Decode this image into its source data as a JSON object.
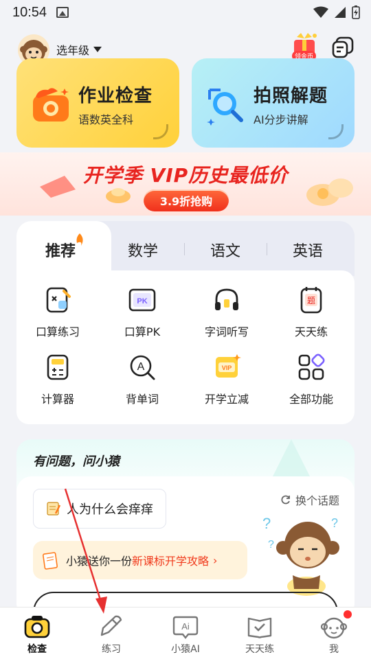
{
  "status_bar": {
    "time": "10:54"
  },
  "header": {
    "grade_label": "选年级",
    "gift_badge": "领金币"
  },
  "cards": [
    {
      "title": "作业检查",
      "subtitle": "语数英全科"
    },
    {
      "title": "拍照解题",
      "subtitle": "AI分步讲解"
    }
  ],
  "banner": {
    "headline": "开学季 VIP历史最低价",
    "button": "3.9折抢购"
  },
  "tabs": [
    {
      "label": "推荐",
      "active": true
    },
    {
      "label": "数学"
    },
    {
      "label": "语文"
    },
    {
      "label": "英语"
    }
  ],
  "functions": [
    {
      "label": "口算练习",
      "icon": "oral-calc-icon"
    },
    {
      "label": "口算PK",
      "icon": "pk-icon"
    },
    {
      "label": "字词听写",
      "icon": "headphones-icon"
    },
    {
      "label": "天天练",
      "icon": "daily-practice-icon"
    },
    {
      "label": "计算器",
      "icon": "calculator-icon"
    },
    {
      "label": "背单词",
      "icon": "dictionary-icon"
    },
    {
      "label": "开学立减",
      "icon": "vip-discount-icon"
    },
    {
      "label": "全部功能",
      "icon": "all-functions-icon"
    }
  ],
  "ask": {
    "title": "有问题，问小猿",
    "topic": "人为什么会痒痒",
    "swap_label": "换个话题",
    "guide_prefix": "小猿送你一份",
    "guide_highlight": "新课标开学攻略",
    "guide_chevron": "›"
  },
  "nav": [
    {
      "label": "检查",
      "active": true,
      "icon": "camera-icon"
    },
    {
      "label": "练习",
      "icon": "pencil-icon"
    },
    {
      "label": "小猿AI",
      "icon": "ai-chat-icon"
    },
    {
      "label": "天天练",
      "icon": "check-book-icon"
    },
    {
      "label": "我",
      "icon": "profile-icon",
      "badge": true
    }
  ],
  "colors": {
    "accent_red": "#f03a1c",
    "hw_card": "#ffd13a",
    "photo_card": "#9fd9ff"
  }
}
